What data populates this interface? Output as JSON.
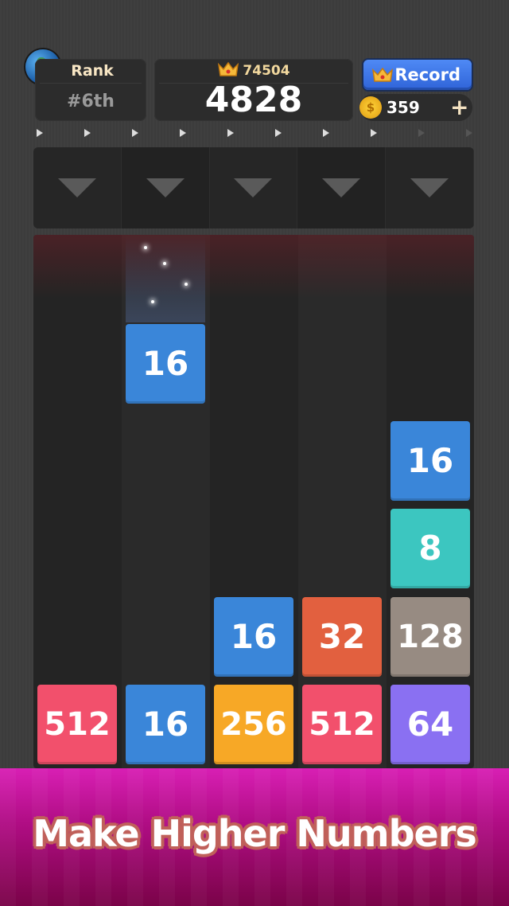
{
  "header": {
    "rank_label": "Rank",
    "rank_value": "#6th",
    "best_score": "74504",
    "score": "4828",
    "record_label": "Record",
    "coins": "359",
    "add_coins_label": "+",
    "coin_symbol": "$"
  },
  "next_indicator": {
    "active": 8,
    "total": 10
  },
  "board": {
    "columns": 5,
    "tiles": [
      {
        "value": "16",
        "column": 1,
        "row": 4.1,
        "falling": true
      },
      {
        "value": "16",
        "column": 4,
        "row": 3
      },
      {
        "value": "8",
        "column": 4,
        "row": 2
      },
      {
        "value": "16",
        "column": 2,
        "row": 1
      },
      {
        "value": "32",
        "column": 3,
        "row": 1
      },
      {
        "value": "128",
        "column": 4,
        "row": 1
      },
      {
        "value": "512",
        "column": 0,
        "row": 0
      },
      {
        "value": "16",
        "column": 1,
        "row": 0
      },
      {
        "value": "256",
        "column": 2,
        "row": 0
      },
      {
        "value": "512",
        "column": 3,
        "row": 0
      },
      {
        "value": "64",
        "column": 4,
        "row": 0
      }
    ]
  },
  "tile_colors": {
    "8": "#3cc6c0",
    "16": "#3a86d9",
    "32": "#e2603f",
    "64": "#8a70f2",
    "128": "#978b82",
    "256": "#f7a826",
    "512": "#f2506c"
  },
  "banner": {
    "text": "Make Higher Numbers"
  }
}
